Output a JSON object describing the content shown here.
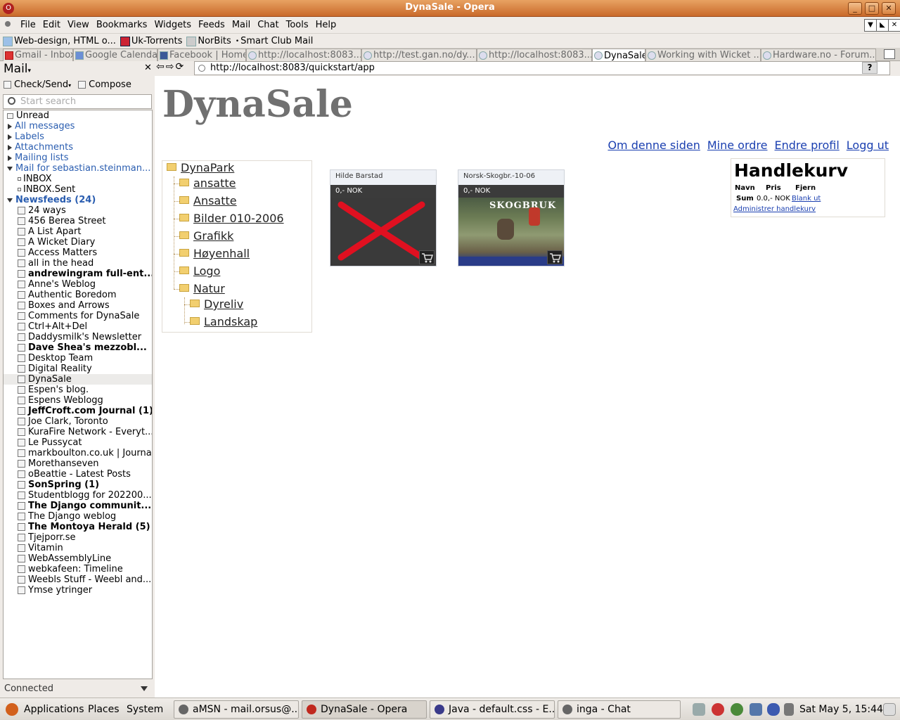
{
  "window": {
    "title": "DynaSale - Opera"
  },
  "menu": [
    "File",
    "Edit",
    "View",
    "Bookmarks",
    "Widgets",
    "Feeds",
    "Mail",
    "Chat",
    "Tools",
    "Help"
  ],
  "bookmarks": [
    "Web-design, HTML o...",
    "Uk-Torrents",
    "NorBits",
    "Smart Club Mail"
  ],
  "tabs": [
    {
      "label": "Gmail - Inbox"
    },
    {
      "label": "Google Calendar"
    },
    {
      "label": "Facebook | Home"
    },
    {
      "label": "http://localhost:8083..."
    },
    {
      "label": "http://test.gan.no/dy..."
    },
    {
      "label": "http://localhost:8083..."
    },
    {
      "label": "DynaSale"
    },
    {
      "label": "Working with Wicket ..."
    },
    {
      "label": "Hardware.no - Forum..."
    }
  ],
  "address": {
    "url": "http://localhost:8083/quickstart/app",
    "help": "?"
  },
  "panel": {
    "title": "Mail",
    "check_send": "Check/Send",
    "compose": "Compose",
    "search_placeholder": "Start search",
    "status": "Connected",
    "items": [
      {
        "label": "Unread",
        "kind": "top"
      },
      {
        "label": "All messages",
        "kind": "group"
      },
      {
        "label": "Labels",
        "kind": "group"
      },
      {
        "label": "Attachments",
        "kind": "group"
      },
      {
        "label": "Mailing lists",
        "kind": "group"
      },
      {
        "label": "Mail for sebastian.steinman...",
        "kind": "open"
      },
      {
        "label": "INBOX",
        "kind": "sub"
      },
      {
        "label": "INBOX.Sent",
        "kind": "sub"
      },
      {
        "label": "Newsfeeds (24)",
        "kind": "openbold"
      },
      {
        "label": "24 ways",
        "kind": "feed"
      },
      {
        "label": "456 Berea Street",
        "kind": "feed"
      },
      {
        "label": "A List Apart",
        "kind": "feed"
      },
      {
        "label": "A Wicket Diary",
        "kind": "feed"
      },
      {
        "label": "Access Matters",
        "kind": "feed"
      },
      {
        "label": "all in the head",
        "kind": "feed"
      },
      {
        "label": "andrewingram full-ent...",
        "kind": "feedbold"
      },
      {
        "label": "Anne's Weblog",
        "kind": "feed"
      },
      {
        "label": "Authentic Boredom",
        "kind": "feed"
      },
      {
        "label": "Boxes and Arrows",
        "kind": "feed"
      },
      {
        "label": "Comments for DynaSale",
        "kind": "feed"
      },
      {
        "label": "Ctrl+Alt+Del",
        "kind": "feed"
      },
      {
        "label": "Daddysmilk's Newsletter",
        "kind": "feed"
      },
      {
        "label": "Dave Shea's mezzobl...",
        "kind": "feedbold"
      },
      {
        "label": "Desktop Team",
        "kind": "feed"
      },
      {
        "label": "Digital Reality",
        "kind": "feed"
      },
      {
        "label": "DynaSale",
        "kind": "feedsel"
      },
      {
        "label": "Espen's blog.",
        "kind": "feed"
      },
      {
        "label": "Espens Weblogg",
        "kind": "feed"
      },
      {
        "label": "JeffCroft.com Journal (1)",
        "kind": "feedbold"
      },
      {
        "label": "Joe Clark, Toronto",
        "kind": "feed"
      },
      {
        "label": "KuraFire Network - Everyt...",
        "kind": "feed"
      },
      {
        "label": "Le Pussycat",
        "kind": "feed"
      },
      {
        "label": "markboulton.co.uk | Journal",
        "kind": "feed"
      },
      {
        "label": "Morethanseven",
        "kind": "feed"
      },
      {
        "label": "oBeattie - Latest Posts",
        "kind": "feed"
      },
      {
        "label": "SonSpring (1)",
        "kind": "feedbold"
      },
      {
        "label": "Studentblogg for 202200...",
        "kind": "feed"
      },
      {
        "label": "The Django communit...",
        "kind": "feedbold"
      },
      {
        "label": "The Django weblog",
        "kind": "feed"
      },
      {
        "label": "The Montoya Herald (5)",
        "kind": "feedbold"
      },
      {
        "label": "Tjejporr.se",
        "kind": "feed"
      },
      {
        "label": "Vitamin",
        "kind": "feed"
      },
      {
        "label": "WebAssemblyLine",
        "kind": "feed"
      },
      {
        "label": "webkafeen: Timeline",
        "kind": "feed"
      },
      {
        "label": "Weebls Stuff  - Weebl and...",
        "kind": "feed"
      },
      {
        "label": "Ymse ytringer",
        "kind": "feed"
      }
    ]
  },
  "page": {
    "heading": "DynaSale",
    "links": [
      "Om denne siden",
      "Mine ordre",
      "Endre profil",
      "Logg ut"
    ],
    "tree": {
      "root": "DynaPark",
      "children": [
        "ansatte",
        "Ansatte",
        "Bilder 010-2006",
        "Grafikk",
        "Høyenhall",
        "Logo",
        "Natur"
      ],
      "natur_children": [
        "Dyreliv",
        "Landskap"
      ]
    },
    "cards": [
      {
        "name": "Hilde Barstad",
        "price": "0,- NOK"
      },
      {
        "name": "Norsk-Skogbr.-10-06",
        "price": "0,- NOK",
        "image_text": "SKOGBRUK"
      }
    ],
    "basket": {
      "title": "Handlekurv",
      "col_name": "Navn",
      "col_price": "Pris",
      "col_remove": "Fjern",
      "sum_label": "Sum",
      "sum_value": "0.0,- NOK",
      "clear": "Blank ut",
      "admin": "Administrer handlekurv"
    }
  },
  "taskbar": {
    "applications": "Applications",
    "places": "Places",
    "system": "System",
    "tasks": [
      "aMSN - mail.orsus@...",
      "DynaSale - Opera",
      "Java - default.css - E...",
      "inga - Chat"
    ],
    "clock": "Sat May  5, 15:44"
  }
}
